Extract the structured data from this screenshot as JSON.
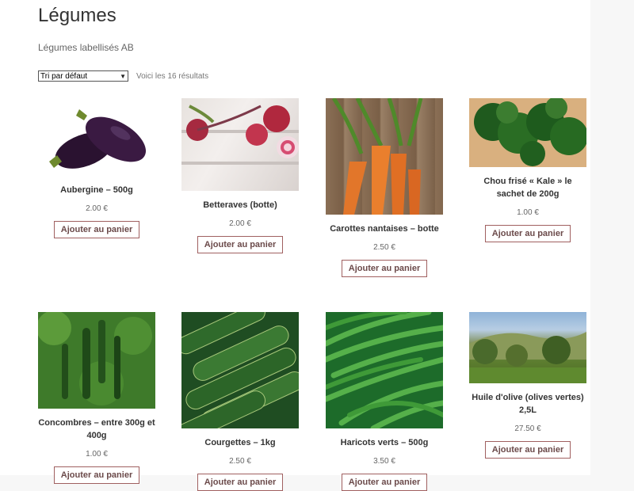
{
  "page": {
    "title": "Légumes",
    "subtitle": "Légumes labellisés AB",
    "sort_value": "Tri par défaut",
    "result_count": "Voici les 16 résultats"
  },
  "products": [
    {
      "name": "Aubergine – 500g",
      "price": "2.00 €",
      "button": "Ajouter au panier",
      "image_icon": "eggplant-image"
    },
    {
      "name": "Betteraves (botte)",
      "price": "2.00 €",
      "button": "Ajouter au panier",
      "image_icon": "beetroot-image"
    },
    {
      "name": "Carottes nantaises – botte",
      "price": "2.50 €",
      "button": "Ajouter au panier",
      "image_icon": "carrot-image"
    },
    {
      "name": "Chou frisé « Kale » le sachet de 200g",
      "price": "1.00 €",
      "button": "Ajouter au panier",
      "image_icon": "kale-image"
    },
    {
      "name": "Concombres – entre 300g et 400g",
      "price": "1.00 €",
      "button": "Ajouter au panier",
      "image_icon": "cucumber-image"
    },
    {
      "name": "Courgettes – 1kg",
      "price": "2.50 €",
      "button": "Ajouter au panier",
      "image_icon": "zucchini-image"
    },
    {
      "name": "Haricots verts – 500g",
      "price": "3.50 €",
      "button": "Ajouter au panier",
      "image_icon": "green-beans-image"
    },
    {
      "name": "Huile d'olive (olives vertes) 2,5L",
      "price": "27.50 €",
      "button": "Ajouter au panier",
      "image_icon": "olive-grove-image"
    }
  ],
  "colors": {
    "button_border": "#a06060",
    "button_text": "#6b4a4a",
    "text_dark": "#333333",
    "text_muted": "#666666"
  }
}
